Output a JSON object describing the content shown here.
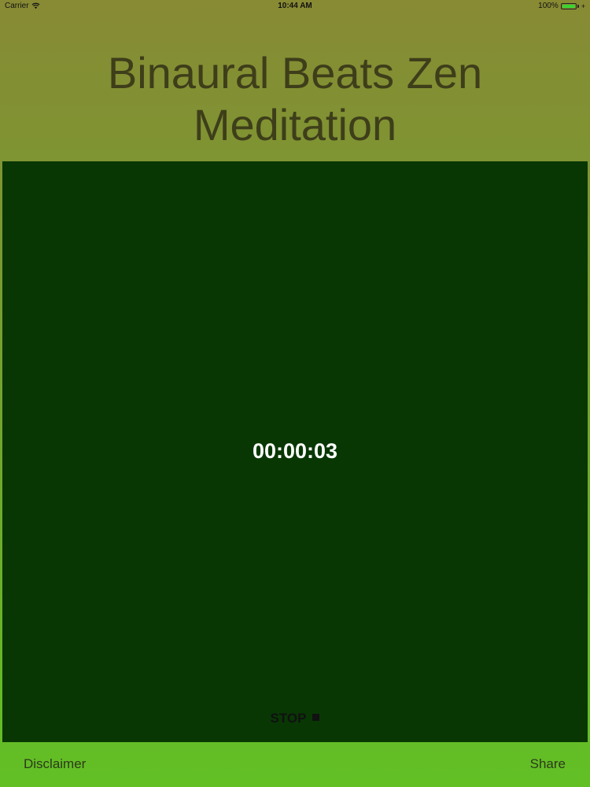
{
  "status_bar": {
    "carrier": "Carrier",
    "time": "10:44 AM",
    "battery_percent": "100%",
    "wifi_icon": "wifi-icon",
    "battery_icon": "battery-icon"
  },
  "header": {
    "title": "Binaural Beats Zen Meditation"
  },
  "main": {
    "timer": "00:00:03",
    "stop_label": "STOP",
    "stop_icon": "stop-square-icon"
  },
  "footer": {
    "disclaimer_label": "Disclaimer",
    "share_label": "Share"
  },
  "colors": {
    "panel_background": "#083704",
    "title_color": "#3e3e1a",
    "gradient_top": "#888a34",
    "gradient_bottom": "#62c025"
  }
}
